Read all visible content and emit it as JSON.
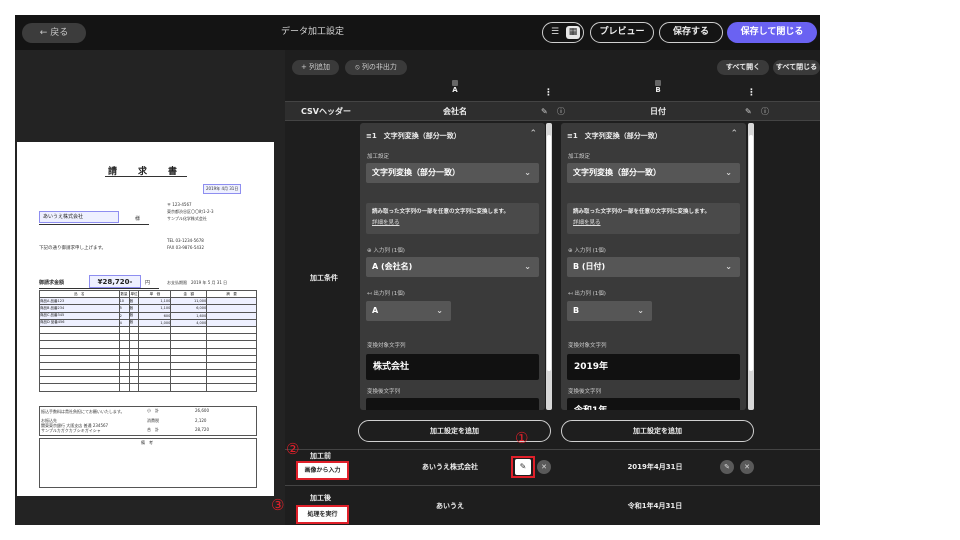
{
  "header": {
    "back_label": "← 戻る",
    "title": "データ加工設定",
    "preview_label": "プレビュー",
    "save_label": "保存する",
    "save_close_label": "保存して閉じる"
  },
  "toolbar": {
    "add_column": "+ 列追加",
    "hide_columns": "⦸ 列の非出力",
    "expand_all": "すべて開く",
    "collapse_all": "すべて閉じる"
  },
  "rows": {
    "csv_header": "CSVヘッダー",
    "conditions": "加工条件",
    "before": "加工前",
    "after": "加工後"
  },
  "side_buttons": {
    "input_from_image": "画像から入力",
    "run": "処理を実行"
  },
  "annotations": [
    "①",
    "②",
    "③"
  ],
  "columns": [
    {
      "letter": "A",
      "header": "会社名",
      "card_title": "≡1　文字列変換（部分一致）",
      "section_label": "加工設定",
      "method": "文字列変換（部分一致）",
      "description": "読み取った文字列の一部を任意の文字列に変換します。",
      "details_link": "詳細を見る",
      "input_label": "⊕ 入力列 (1個)",
      "input_value": "A (会社名)",
      "output_label": "↤ 出力列 (1個)",
      "output_value": "A",
      "target_label": "変換対象文字列",
      "target_value": "株式会社",
      "replace_label": "変換後文字列",
      "replace_value": "",
      "add_button": "加工設定を追加",
      "before_value": "あいうえ株式会社",
      "after_value": "あいうえ"
    },
    {
      "letter": "B",
      "header": "日付",
      "card_title": "≡1　文字列変換（部分一致）",
      "section_label": "加工設定",
      "method": "文字列変換（部分一致）",
      "description": "読み取った文字列の一部を任意の文字列に変換します。",
      "details_link": "詳細を見る",
      "input_label": "⊕ 入力列 (1個)",
      "input_value": "B (日付)",
      "output_label": "↤ 出力列 (1個)",
      "output_value": "B",
      "target_label": "変換対象文字列",
      "target_value": "2019年",
      "replace_label": "変換後文字列",
      "replace_value": "令和1年",
      "add_button": "加工設定を追加",
      "before_value": "2019年4月31日",
      "after_value": "令和1年4月31日"
    }
  ],
  "document": {
    "title": "請　求　書",
    "date": "2019年 4月 31日",
    "company": "あいうえ株式会社",
    "honorific": "様",
    "sender": [
      "〒 123-4567",
      "東京都渋谷区〇〇町1-2-3",
      "サンプル化学株式会社"
    ],
    "tel": "TEL  03-1234-5678",
    "fax": "FAX  03-9876-5432",
    "note": "下記の通り御請求申し上げます。",
    "amount_label": "御請求金額",
    "amount": "¥28,720-",
    "amount_suffix": "円",
    "due": "お支払期限　2019 年 5 月 31 日",
    "table_header": [
      "品　名",
      "数量",
      "単位",
      "単　価",
      "金　額",
      "摘　要"
    ],
    "items": [
      [
        "商品A 品番123",
        "10",
        "個",
        "1,100",
        "11,000",
        ""
      ],
      [
        "商品B 品番234",
        "5",
        "個",
        "1,100",
        "6,000",
        ""
      ],
      [
        "商品C 品番345",
        "2",
        "個",
        "600",
        "1,600",
        ""
      ],
      [
        "商品D 品番456",
        "4",
        "個",
        "1,000",
        "4,000",
        ""
      ]
    ],
    "subtotal_label": "小　計",
    "subtotal": "26,600",
    "tax_label": "消費税",
    "tax": "2,120",
    "total_label": "合　計",
    "total": "28,720",
    "transfer_note": "振込手数料は貴社負担にてお願いいたします。",
    "bank": [
      "お振込先",
      "関東東京銀行 大阪支店 普通 234567",
      "サンプルカガクカブシキガイシャ"
    ],
    "remarks_label": "備　考"
  }
}
